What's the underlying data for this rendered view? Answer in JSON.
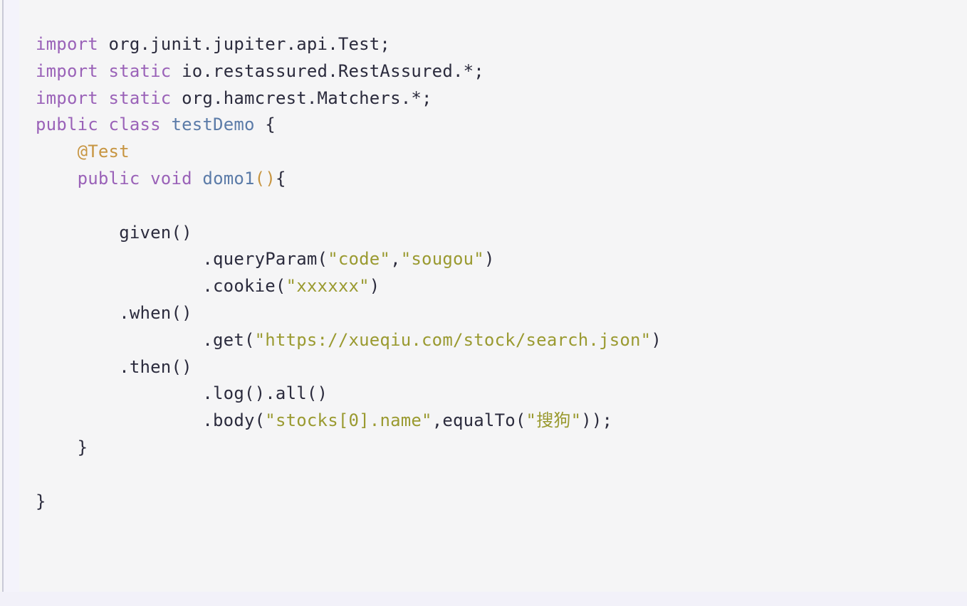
{
  "editor": {
    "language": "Java",
    "background_color": "#f5f5f6",
    "text_color": "#2b2b3d",
    "colors": {
      "keyword": "#9a62b8",
      "type": "#5b7ba8",
      "annotation": "#c79541",
      "string": "#9a9a30",
      "punctuation": "#c79541",
      "plain": "#2b2b3d",
      "left_rule": "#c9c9d6",
      "left_strip": "#f4f3fb",
      "bottom_band": "#f2f1f9"
    }
  },
  "code": {
    "full_text": "import org.junit.jupiter.api.Test;\nimport static io.restassured.RestAssured.*;\nimport static org.hamcrest.Matchers.*;\npublic class testDemo {\n    @Test\n    public void domo1(){\n\n        given()\n                .queryParam(\"code\",\"sougou\")\n                .cookie(\"xxxxxx\")\n        .when()\n                .get(\"https://xueqiu.com/stock/search.json\")\n        .then()\n                .log().all()\n                .body(\"stocks[0].name\",equalTo(\"搜狗\"));\n    }\n\n}",
    "lines": [
      {
        "index": 1,
        "text": "import org.junit.jupiter.api.Test;",
        "tokens": [
          {
            "t": "import",
            "c": "keyword"
          },
          {
            "t": " org.junit.jupiter.api.Test;",
            "c": "plain"
          }
        ]
      },
      {
        "index": 2,
        "text": "import static io.restassured.RestAssured.*;",
        "tokens": [
          {
            "t": "import static",
            "c": "keyword"
          },
          {
            "t": " io.restassured.RestAssured.*;",
            "c": "plain"
          }
        ]
      },
      {
        "index": 3,
        "text": "import static org.hamcrest.Matchers.*;",
        "tokens": [
          {
            "t": "import static",
            "c": "keyword"
          },
          {
            "t": " org.hamcrest.Matchers.*;",
            "c": "plain"
          }
        ]
      },
      {
        "index": 4,
        "text": "public class testDemo {",
        "tokens": [
          {
            "t": "public class",
            "c": "keyword"
          },
          {
            "t": " ",
            "c": "plain"
          },
          {
            "t": "testDemo",
            "c": "type"
          },
          {
            "t": " {",
            "c": "plain"
          }
        ]
      },
      {
        "index": 5,
        "text": "    @Test",
        "tokens": [
          {
            "t": "    ",
            "c": "plain"
          },
          {
            "t": "@Test",
            "c": "annotation"
          }
        ]
      },
      {
        "index": 6,
        "text": "    public void domo1(){",
        "tokens": [
          {
            "t": "    ",
            "c": "plain"
          },
          {
            "t": "public void",
            "c": "keyword"
          },
          {
            "t": " ",
            "c": "plain"
          },
          {
            "t": "domo1",
            "c": "type"
          },
          {
            "t": "()",
            "c": "punctuation"
          },
          {
            "t": "{",
            "c": "plain"
          }
        ]
      },
      {
        "index": 7,
        "text": "",
        "tokens": []
      },
      {
        "index": 8,
        "text": "        given()",
        "tokens": [
          {
            "t": "        given()",
            "c": "plain"
          }
        ]
      },
      {
        "index": 9,
        "text": "                .queryParam(\"code\",\"sougou\")",
        "tokens": [
          {
            "t": "                .queryParam(",
            "c": "plain"
          },
          {
            "t": "\"code\"",
            "c": "string"
          },
          {
            "t": ",",
            "c": "plain"
          },
          {
            "t": "\"sougou\"",
            "c": "string"
          },
          {
            "t": ")",
            "c": "plain"
          }
        ]
      },
      {
        "index": 10,
        "text": "                .cookie(\"xxxxxx\")",
        "tokens": [
          {
            "t": "                .cookie(",
            "c": "plain"
          },
          {
            "t": "\"xxxxxx\"",
            "c": "string"
          },
          {
            "t": ")",
            "c": "plain"
          }
        ]
      },
      {
        "index": 11,
        "text": "        .when()",
        "tokens": [
          {
            "t": "        .when()",
            "c": "plain"
          }
        ]
      },
      {
        "index": 12,
        "text": "                .get(\"https://xueqiu.com/stock/search.json\")",
        "tokens": [
          {
            "t": "                .get(",
            "c": "plain"
          },
          {
            "t": "\"https://xueqiu.com/stock/search.json\"",
            "c": "string"
          },
          {
            "t": ")",
            "c": "plain"
          }
        ]
      },
      {
        "index": 13,
        "text": "        .then()",
        "tokens": [
          {
            "t": "        .then()",
            "c": "plain"
          }
        ]
      },
      {
        "index": 14,
        "text": "                .log().all()",
        "tokens": [
          {
            "t": "                .log().all()",
            "c": "plain"
          }
        ]
      },
      {
        "index": 15,
        "text": "                .body(\"stocks[0].name\",equalTo(\"搜狗\"));",
        "tokens": [
          {
            "t": "                .body(",
            "c": "plain"
          },
          {
            "t": "\"stocks[0].name\"",
            "c": "string"
          },
          {
            "t": ",equalTo(",
            "c": "plain"
          },
          {
            "t": "\"",
            "c": "string"
          },
          {
            "t": "搜狗",
            "c": "cjk"
          },
          {
            "t": "\"",
            "c": "string"
          },
          {
            "t": "));",
            "c": "plain"
          }
        ]
      },
      {
        "index": 16,
        "text": "    }",
        "tokens": [
          {
            "t": "    }",
            "c": "plain"
          }
        ]
      },
      {
        "index": 17,
        "text": "",
        "tokens": []
      },
      {
        "index": 18,
        "text": "}",
        "tokens": [
          {
            "t": "}",
            "c": "plain"
          }
        ]
      }
    ]
  }
}
